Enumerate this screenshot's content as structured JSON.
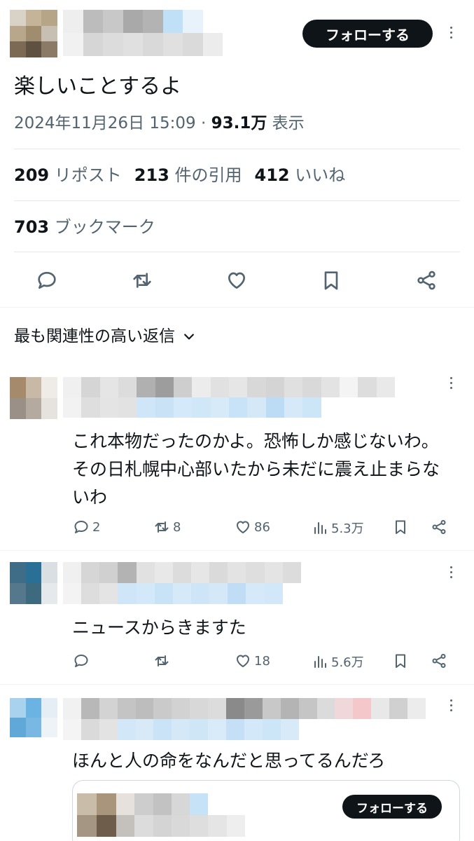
{
  "tweet": {
    "follow_label": "フォローする",
    "text": "楽しいことするよ",
    "datetime": "2024年11月26日 15:09",
    "dot": "·",
    "views_count": "93.1万",
    "views_label": "表示",
    "reposts_count": "209",
    "reposts_label": "リポスト",
    "quotes_count": "213",
    "quotes_label": "件の引用",
    "likes_count": "412",
    "likes_label": "いいね",
    "bookmarks_count": "703",
    "bookmarks_label": "ブックマーク"
  },
  "sort_label": "最も関連性の高い返信",
  "replies": [
    {
      "text": "これ本物だったのかよ。恐怖しか感じないわ。その日札幌中心部いたから未だに震え止まらないわ",
      "replies": "2",
      "reposts": "8",
      "likes": "86",
      "views": "5.3万"
    },
    {
      "text": "ニュースからきますた",
      "replies": "",
      "reposts": "",
      "likes": "18",
      "views": "5.6万"
    },
    {
      "text": "ほんと人の命をなんだと思ってるんだろ",
      "follow_label": "フォローする"
    }
  ],
  "colors": {
    "text": "#0f1419",
    "secondary": "#536471",
    "divider": "#eff3f4",
    "button": "#0f1419"
  },
  "icons": [
    "reply-icon",
    "repost-icon",
    "like-icon",
    "bookmark-icon",
    "share-icon",
    "views-icon",
    "chevron-down-icon",
    "more-icon"
  ]
}
